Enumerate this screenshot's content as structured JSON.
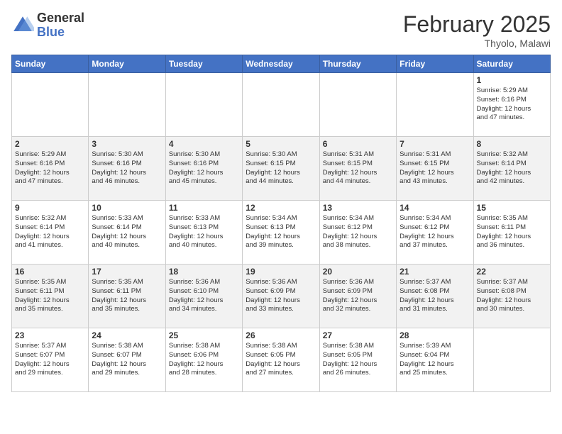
{
  "logo": {
    "general": "General",
    "blue": "Blue"
  },
  "header": {
    "month": "February 2025",
    "location": "Thyolo, Malawi"
  },
  "weekdays": [
    "Sunday",
    "Monday",
    "Tuesday",
    "Wednesday",
    "Thursday",
    "Friday",
    "Saturday"
  ],
  "weeks": [
    [
      {
        "day": "",
        "info": ""
      },
      {
        "day": "",
        "info": ""
      },
      {
        "day": "",
        "info": ""
      },
      {
        "day": "",
        "info": ""
      },
      {
        "day": "",
        "info": ""
      },
      {
        "day": "",
        "info": ""
      },
      {
        "day": "1",
        "info": "Sunrise: 5:29 AM\nSunset: 6:16 PM\nDaylight: 12 hours\nand 47 minutes."
      }
    ],
    [
      {
        "day": "2",
        "info": "Sunrise: 5:29 AM\nSunset: 6:16 PM\nDaylight: 12 hours\nand 47 minutes."
      },
      {
        "day": "3",
        "info": "Sunrise: 5:30 AM\nSunset: 6:16 PM\nDaylight: 12 hours\nand 46 minutes."
      },
      {
        "day": "4",
        "info": "Sunrise: 5:30 AM\nSunset: 6:16 PM\nDaylight: 12 hours\nand 45 minutes."
      },
      {
        "day": "5",
        "info": "Sunrise: 5:30 AM\nSunset: 6:15 PM\nDaylight: 12 hours\nand 44 minutes."
      },
      {
        "day": "6",
        "info": "Sunrise: 5:31 AM\nSunset: 6:15 PM\nDaylight: 12 hours\nand 44 minutes."
      },
      {
        "day": "7",
        "info": "Sunrise: 5:31 AM\nSunset: 6:15 PM\nDaylight: 12 hours\nand 43 minutes."
      },
      {
        "day": "8",
        "info": "Sunrise: 5:32 AM\nSunset: 6:14 PM\nDaylight: 12 hours\nand 42 minutes."
      }
    ],
    [
      {
        "day": "9",
        "info": "Sunrise: 5:32 AM\nSunset: 6:14 PM\nDaylight: 12 hours\nand 41 minutes."
      },
      {
        "day": "10",
        "info": "Sunrise: 5:33 AM\nSunset: 6:14 PM\nDaylight: 12 hours\nand 40 minutes."
      },
      {
        "day": "11",
        "info": "Sunrise: 5:33 AM\nSunset: 6:13 PM\nDaylight: 12 hours\nand 40 minutes."
      },
      {
        "day": "12",
        "info": "Sunrise: 5:34 AM\nSunset: 6:13 PM\nDaylight: 12 hours\nand 39 minutes."
      },
      {
        "day": "13",
        "info": "Sunrise: 5:34 AM\nSunset: 6:12 PM\nDaylight: 12 hours\nand 38 minutes."
      },
      {
        "day": "14",
        "info": "Sunrise: 5:34 AM\nSunset: 6:12 PM\nDaylight: 12 hours\nand 37 minutes."
      },
      {
        "day": "15",
        "info": "Sunrise: 5:35 AM\nSunset: 6:11 PM\nDaylight: 12 hours\nand 36 minutes."
      }
    ],
    [
      {
        "day": "16",
        "info": "Sunrise: 5:35 AM\nSunset: 6:11 PM\nDaylight: 12 hours\nand 35 minutes."
      },
      {
        "day": "17",
        "info": "Sunrise: 5:35 AM\nSunset: 6:11 PM\nDaylight: 12 hours\nand 35 minutes."
      },
      {
        "day": "18",
        "info": "Sunrise: 5:36 AM\nSunset: 6:10 PM\nDaylight: 12 hours\nand 34 minutes."
      },
      {
        "day": "19",
        "info": "Sunrise: 5:36 AM\nSunset: 6:09 PM\nDaylight: 12 hours\nand 33 minutes."
      },
      {
        "day": "20",
        "info": "Sunrise: 5:36 AM\nSunset: 6:09 PM\nDaylight: 12 hours\nand 32 minutes."
      },
      {
        "day": "21",
        "info": "Sunrise: 5:37 AM\nSunset: 6:08 PM\nDaylight: 12 hours\nand 31 minutes."
      },
      {
        "day": "22",
        "info": "Sunrise: 5:37 AM\nSunset: 6:08 PM\nDaylight: 12 hours\nand 30 minutes."
      }
    ],
    [
      {
        "day": "23",
        "info": "Sunrise: 5:37 AM\nSunset: 6:07 PM\nDaylight: 12 hours\nand 29 minutes."
      },
      {
        "day": "24",
        "info": "Sunrise: 5:38 AM\nSunset: 6:07 PM\nDaylight: 12 hours\nand 29 minutes."
      },
      {
        "day": "25",
        "info": "Sunrise: 5:38 AM\nSunset: 6:06 PM\nDaylight: 12 hours\nand 28 minutes."
      },
      {
        "day": "26",
        "info": "Sunrise: 5:38 AM\nSunset: 6:05 PM\nDaylight: 12 hours\nand 27 minutes."
      },
      {
        "day": "27",
        "info": "Sunrise: 5:38 AM\nSunset: 6:05 PM\nDaylight: 12 hours\nand 26 minutes."
      },
      {
        "day": "28",
        "info": "Sunrise: 5:39 AM\nSunset: 6:04 PM\nDaylight: 12 hours\nand 25 minutes."
      },
      {
        "day": "",
        "info": ""
      }
    ]
  ]
}
